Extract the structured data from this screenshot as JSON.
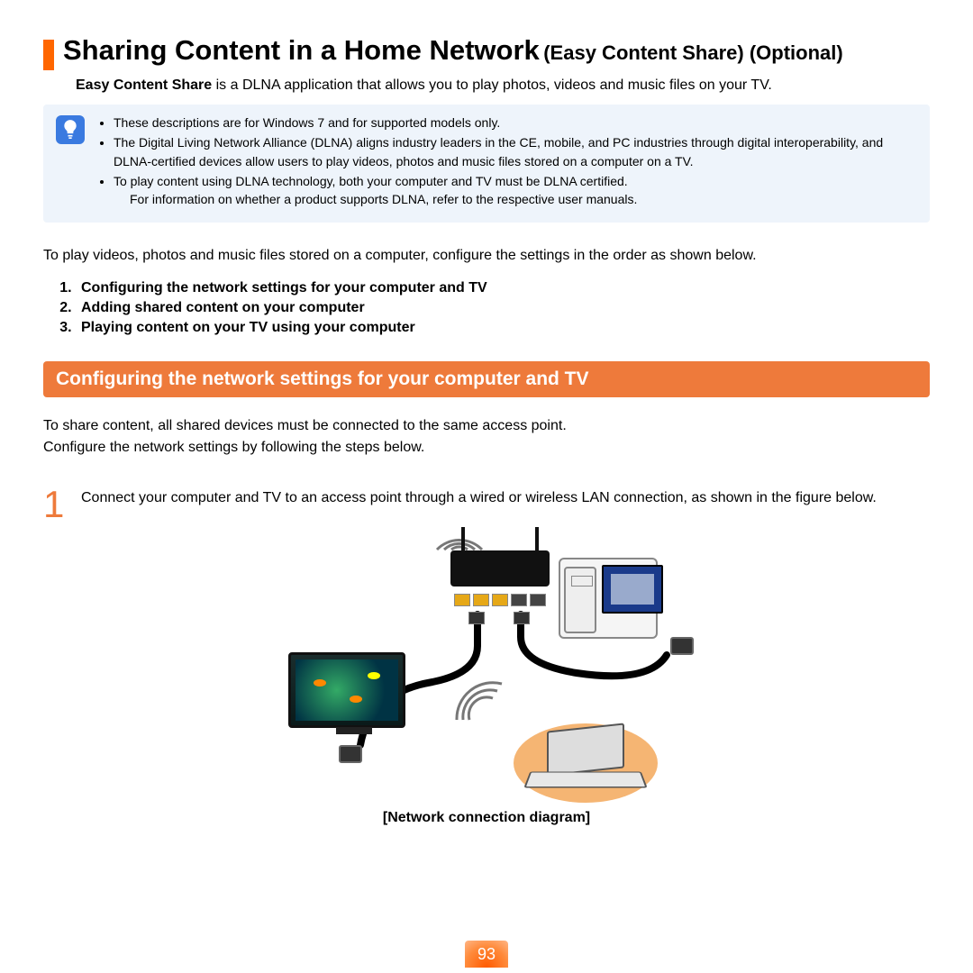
{
  "title_main": "Sharing Content in a Home Network",
  "title_paren": "(Easy Content Share) (Optional)",
  "intro_bold": "Easy Content Share",
  "intro_rest": " is a DLNA application that allows you to play photos, videos and music files on your TV.",
  "tips": {
    "item1": "These descriptions are for Windows 7 and for supported models only.",
    "item2": "The Digital Living Network Alliance (DLNA) aligns industry leaders in the CE, mobile, and PC industries through digital interoperability, and DLNA-certified devices allow users to play videos, photos and music files stored on a computer on a TV.",
    "item3": "To play content using DLNA technology, both your computer and TV must be DLNA certified.",
    "item3_sub": "For information on whether a product supports DLNA, refer to the respective user manuals."
  },
  "body_intro": "To play videos, photos and music files stored on a computer, configure the settings in the order as shown below.",
  "steps_list": {
    "s1": "Configuring the network settings for your computer and TV",
    "s2": "Adding shared content on your computer",
    "s3": "Playing content on your TV using your computer"
  },
  "section_header": "Configuring the network settings for your computer and TV",
  "sect_p1": "To share content, all shared devices must be connected to the same access point.",
  "sect_p2": "Configure the network settings by following the steps below.",
  "step1_num": "1",
  "step1_text": "Connect your computer and TV to an access point through a wired or wireless LAN connection, as shown in the figure below.",
  "diagram_caption": "[Network connection diagram]",
  "page_number": "93"
}
